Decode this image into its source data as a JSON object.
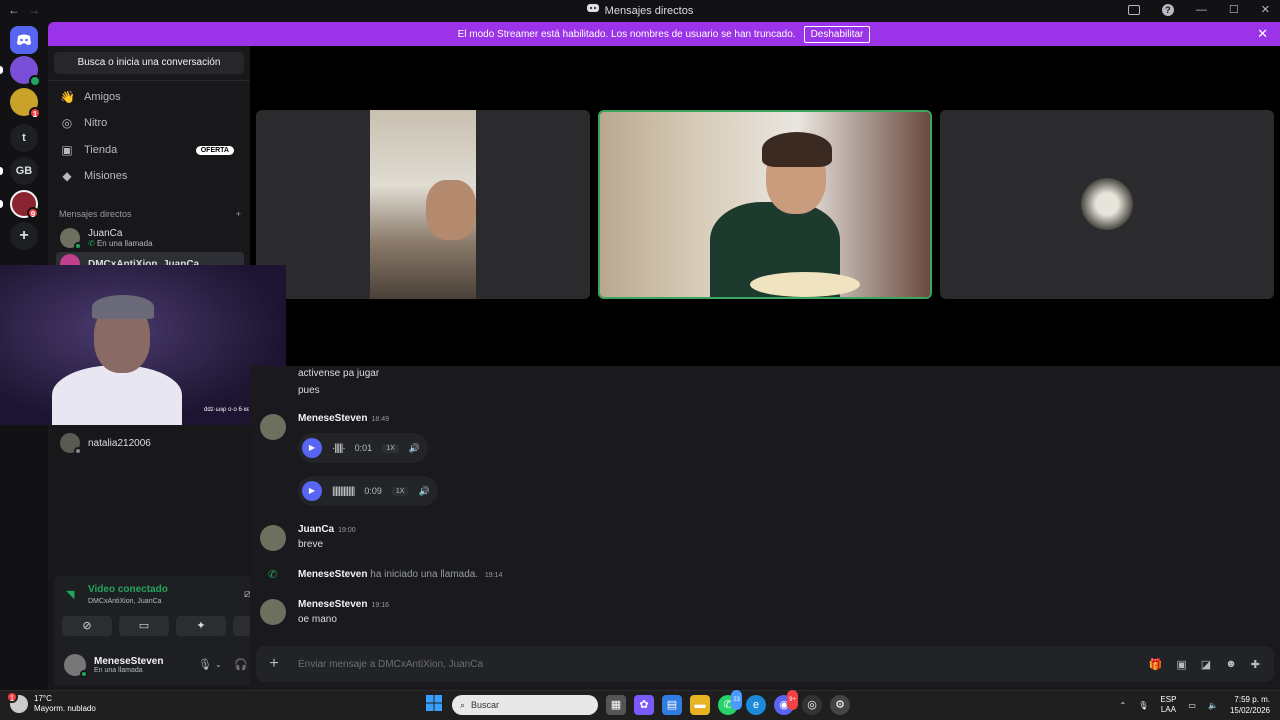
{
  "window": {
    "title": "Mensajes directos",
    "back": "←",
    "forward": "→"
  },
  "banner": {
    "text": "El modo Streamer está habilitado. Los nombres de usuario se han truncado.",
    "button": "Deshabilitar",
    "close": "✕"
  },
  "rail": {
    "servers": [
      {
        "label": "",
        "badge": ""
      },
      {
        "label": "",
        "badge": "1"
      },
      {
        "label": "t",
        "badge": ""
      },
      {
        "label": "GB",
        "badge": ""
      },
      {
        "label": "",
        "badge": "9"
      },
      {
        "label": "+",
        "badge": ""
      }
    ]
  },
  "sidebar": {
    "search": "Busca o inicia una conversación",
    "nav": [
      {
        "label": "Amigos",
        "icon": "friends-icon"
      },
      {
        "label": "Nitro",
        "icon": "nitro-icon"
      },
      {
        "label": "Tienda",
        "icon": "shop-icon",
        "badge": "OFERTA"
      },
      {
        "label": "Misiones",
        "icon": "quests-icon"
      }
    ],
    "dm_header": "Mensajes directos",
    "dms": [
      {
        "name": "JuanCa",
        "sub": "En una llamada"
      },
      {
        "name": "DMCxAntiXion, JuanCa",
        "sub": ""
      },
      {
        "name": "natalia212006",
        "sub": ""
      }
    ]
  },
  "voice": {
    "title": "Video conectado",
    "subtitle": "DMCxAntiXion, JuanCa",
    "user": {
      "name": "MeneseSteven",
      "status": "En una llamada"
    }
  },
  "cam": {
    "overlay_text": "ddz·ωιιρ ο·ο 6·ιιε"
  },
  "chat": {
    "lines": [
      "activense pa jugar",
      "pues"
    ],
    "m1": {
      "author": "MeneseSteven",
      "time": "18:49"
    },
    "audio1": {
      "duration": "0:01",
      "speed": "1X"
    },
    "audio2": {
      "duration": "0:09",
      "speed": "1X"
    },
    "m2": {
      "author": "JuanCa",
      "time": "19:00",
      "text": "breve"
    },
    "call": {
      "author": "MeneseSteven",
      "text": "ha iniciado una llamada.",
      "time": "19:14"
    },
    "m3": {
      "author": "MeneseSteven",
      "time": "19:16",
      "text": "oe mano"
    }
  },
  "composer": {
    "placeholder": "Enviar mensaje a DMCxAntiXion, JuanCa"
  },
  "taskbar": {
    "weather_badge": "1",
    "temp": "17°C",
    "weather": "Mayorm. nublado",
    "search": "Buscar",
    "whatsapp_badge": "23",
    "discord_badge": "9+",
    "lang1": "ESP",
    "lang2": "LAA",
    "time": "7:59 p. m.",
    "date": "15/02/2026"
  },
  "colors": {
    "accent": "#5865f2",
    "banner": "#9b33e8",
    "online": "#23a55a",
    "speaking": "#3ba55d"
  }
}
